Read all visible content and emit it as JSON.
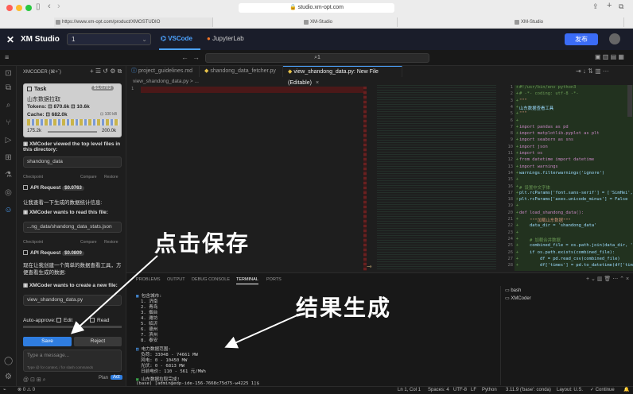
{
  "browser": {
    "url": "studio.xm-opt.com",
    "tab1": "https://www.xm-opt.com/product/XMOSTUDIO",
    "tab2": "XM-Studio",
    "tab3": "XM-Studio"
  },
  "app": {
    "name": "XM Studio",
    "project_select": "1",
    "tab_vscode": "VSCode",
    "tab_jupyter": "JupyterLab",
    "publish_button": "发布"
  },
  "vscode": {
    "search": "1"
  },
  "sidebar": {
    "title": "XMCODER (⌘+`)",
    "task": {
      "title": "Task",
      "cost": "$1.0703",
      "name": "山东数据拉取",
      "tokens": "Tokens: ⊡ 870.6k ⊡ 10.6k",
      "cache": "Cache: ⊡ 682.0k",
      "cache_size": "⊡ 100 kB",
      "ctx_used": "175.2k",
      "ctx_max": "200.0k"
    },
    "msg1": "XMCoder viewed the top level files in this directory:",
    "dir1": "shandong_data",
    "checkpoint": "Checkpoint",
    "compare": "Compare",
    "restore": "Restore",
    "api1": "API Request",
    "api1_cost": "$0.0763",
    "user1": "让我查看一下生成的数据统计信息:",
    "msg2": "XMCoder wants to read this file:",
    "file1": "...ng_data/shandong_data_stats.json",
    "api2": "API Request",
    "api2_cost": "$0.0809",
    "user2": "现在让我创建一个简单的数据查看工具，方便查看生成的数据:",
    "msg3": "XMCoder wants to create a new file:",
    "file2": "view_shandong_data.py",
    "auto_approve": "Auto-approve:",
    "auto_edit": "Edit",
    "auto_read": "Read",
    "save": "Save",
    "reject": "Reject",
    "input_placeholder": "Type a message...",
    "input_hint": "Type @ for context, / for slash commands",
    "plan": "Plan",
    "act": "Act"
  },
  "editor": {
    "tabs": [
      "project_guidelines.md",
      "shandong_data_fetcher.py",
      "view_shandong_data.py: New File (Editable)"
    ],
    "breadcrumb": "view_shandong_data.py > ...",
    "lines": [
      {
        "n": "1",
        "t": "#!/usr/bin/env python3"
      },
      {
        "n": "2",
        "t": "# -*- coding: utf-8 -*-"
      },
      {
        "n": "3",
        "t": "\"\"\""
      },
      {
        "n": "4",
        "t": "山东数据查看工具"
      },
      {
        "n": "5",
        "t": "\"\"\""
      },
      {
        "n": "6",
        "t": ""
      },
      {
        "n": "7",
        "t": "import pandas as pd"
      },
      {
        "n": "8",
        "t": "import matplotlib.pyplot as plt"
      },
      {
        "n": "9",
        "t": "import seaborn as sns"
      },
      {
        "n": "10",
        "t": "import json"
      },
      {
        "n": "11",
        "t": "import os"
      },
      {
        "n": "12",
        "t": "from datetime import datetime"
      },
      {
        "n": "13",
        "t": "import warnings"
      },
      {
        "n": "14",
        "t": "warnings.filterwarnings('ignore')"
      },
      {
        "n": "15",
        "t": ""
      },
      {
        "n": "16",
        "t": "# 设置中文字体"
      },
      {
        "n": "17",
        "t": "plt.rcParams['font.sans-serif'] = ['SimHei', 'Heiti TC']"
      },
      {
        "n": "18",
        "t": "plt.rcParams['axes.unicode_minus'] = False"
      },
      {
        "n": "19",
        "t": ""
      },
      {
        "n": "20",
        "t": "def load_shandong_data():"
      },
      {
        "n": "21",
        "t": "    \"\"\"加载山东数据\"\"\""
      },
      {
        "n": "22",
        "t": "    data_dir = 'shandong_data'"
      },
      {
        "n": "23",
        "t": ""
      },
      {
        "n": "24",
        "t": "    # 加载合并数据"
      },
      {
        "n": "25",
        "t": "    combined_file = os.path.join(data_dir, 'shandong_combined_data.csv')"
      },
      {
        "n": "26",
        "t": "    if os.path.exists(combined_file):"
      },
      {
        "n": "27",
        "t": "        df = pd.read_csv(combined_file)"
      },
      {
        "n": "28",
        "t": "        df['times'] = pd.to_datetime(df['times'])"
      }
    ]
  },
  "panel": {
    "tabs": [
      "PROBLEMS",
      "OUTPUT",
      "DEBUG CONSOLE",
      "TERMINAL",
      "PORTS"
    ],
    "terminals": [
      "bash",
      "XMCoder"
    ],
    "term_lines": [
      "包含城市:",
      "1. 济南",
      "2. 青岛",
      "3. 烟台",
      "4. 潍坊",
      "5. 临沂",
      "6. 德州",
      "7. 滨州",
      "8. 泰安"
    ],
    "power_head": "电力数据范围:",
    "power_lines": [
      "负荷: 33048 - 74661 MW",
      "风电: 0 - 10450 MW",
      "光伏: 0 - 6813 MW",
      "日前电价: 110 - 561 元/MWh"
    ],
    "done": "山东数据拉取完成!",
    "prompt": "(base) [admin@edp-ide-156-7668c75d75-w4225 1]$"
  },
  "annotations": {
    "click_save": "点击保存",
    "result": "结果生成"
  },
  "status": {
    "errors": "⊗ 0 ⚠ 0",
    "position": "Ln 1, Col 1",
    "spaces": "Spaces: 4",
    "encoding": "UTF-8",
    "eol": "LF",
    "lang": "Python",
    "interp": "3.11.9 ('base': conda)",
    "layout": "Layout: U.S.",
    "continue": "✓ Continue"
  }
}
